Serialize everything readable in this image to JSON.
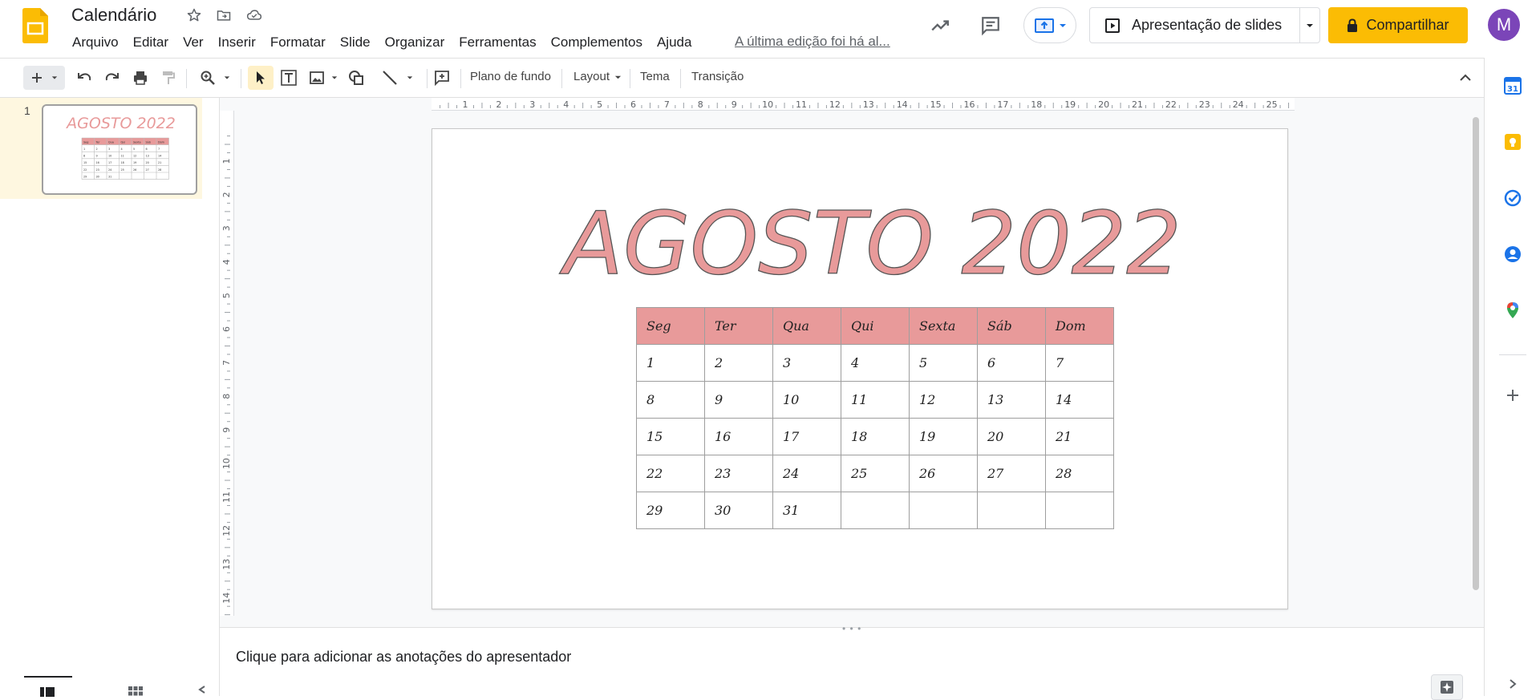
{
  "header": {
    "title": "Calendário",
    "menu": [
      "Arquivo",
      "Editar",
      "Ver",
      "Inserir",
      "Formatar",
      "Slide",
      "Organizar",
      "Ferramentas",
      "Complementos",
      "Ajuda"
    ],
    "last_edit": "A última edição foi há al...",
    "slideshow_label": "Apresentação de slides",
    "share_label": "Compartilhar",
    "avatar_letter": "M"
  },
  "toolbar": {
    "background_label": "Plano de fundo",
    "layout_label": "Layout",
    "theme_label": "Tema",
    "transition_label": "Transição"
  },
  "filmstrip": {
    "slide_number": "1"
  },
  "slide": {
    "title": "AGOSTO 2022",
    "title_color": "#e89a9a",
    "header_color": "#e89a9a",
    "weekdays": [
      "Seg",
      "Ter",
      "Qua",
      "Qui",
      "Sexta",
      "Sáb",
      "Dom"
    ],
    "weeks": [
      [
        "1",
        "2",
        "3",
        "4",
        "5",
        "6",
        "7"
      ],
      [
        "8",
        "9",
        "10",
        "11",
        "12",
        "13",
        "14"
      ],
      [
        "15",
        "16",
        "17",
        "18",
        "19",
        "20",
        "21"
      ],
      [
        "22",
        "23",
        "24",
        "25",
        "26",
        "27",
        "28"
      ],
      [
        "29",
        "30",
        "31",
        "",
        "",
        "",
        ""
      ]
    ]
  },
  "ruler": {
    "horizontal": [
      "1",
      "2",
      "3",
      "4",
      "5",
      "6",
      "7",
      "8",
      "9",
      "10",
      "11",
      "12",
      "13",
      "14",
      "15",
      "16",
      "17",
      "18",
      "19",
      "20",
      "21",
      "22",
      "23",
      "24",
      "25"
    ],
    "vertical": [
      "1",
      "2",
      "3",
      "4",
      "5",
      "6",
      "7",
      "8",
      "9",
      "10",
      "11",
      "12",
      "13",
      "14"
    ]
  },
  "notes": {
    "placeholder": "Clique para adicionar as anotações do apresentador"
  },
  "icons": {
    "app_logo": "slides-logo-icon",
    "star": "star-icon",
    "move": "move-to-folder-icon",
    "cloud": "cloud-status-icon",
    "activity": "activity-trend-icon",
    "comments": "comments-icon",
    "present": "present-to-meeting-icon",
    "share_lock": "lock-icon"
  }
}
